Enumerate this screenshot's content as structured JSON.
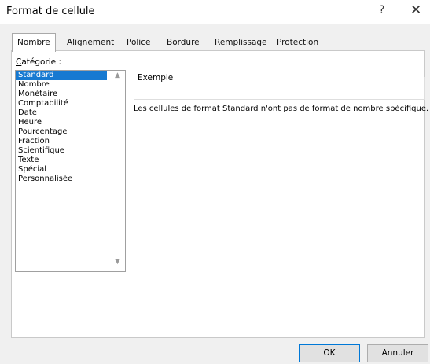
{
  "dialog": {
    "title": "Format de cellule",
    "help_label": "?",
    "close_label": "✕"
  },
  "tabs": [
    {
      "label": "Nombre",
      "active": true
    },
    {
      "label": "Alignement",
      "active": false
    },
    {
      "label": "Police",
      "active": false
    },
    {
      "label": "Bordure",
      "active": false
    },
    {
      "label": "Remplissage",
      "active": false
    },
    {
      "label": "Protection",
      "active": false
    }
  ],
  "category": {
    "label_accel": "C",
    "label_rest": "atégorie :",
    "items": [
      {
        "label": "Standard",
        "selected": true
      },
      {
        "label": "Nombre",
        "selected": false
      },
      {
        "label": "Monétaire",
        "selected": false
      },
      {
        "label": "Comptabilité",
        "selected": false
      },
      {
        "label": "Date",
        "selected": false
      },
      {
        "label": "Heure",
        "selected": false
      },
      {
        "label": "Pourcentage",
        "selected": false
      },
      {
        "label": "Fraction",
        "selected": false
      },
      {
        "label": "Scientifique",
        "selected": false
      },
      {
        "label": "Texte",
        "selected": false
      },
      {
        "label": "Spécial",
        "selected": false
      },
      {
        "label": "Personnalisée",
        "selected": false
      }
    ]
  },
  "sample": {
    "label": "Exemple",
    "value": ""
  },
  "description": "Les cellules de format Standard n'ont pas de format de nombre spécifique.",
  "buttons": {
    "ok": "OK",
    "cancel": "Annuler"
  },
  "colors": {
    "selection": "#1679d1",
    "ok_border": "#0078d7"
  }
}
